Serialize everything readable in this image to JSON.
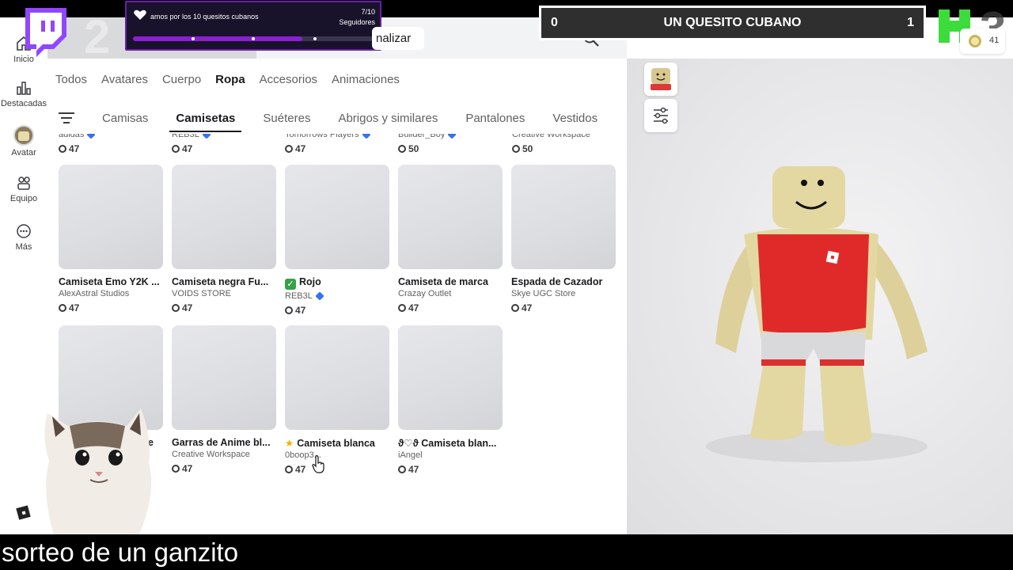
{
  "sidebar": {
    "items": [
      {
        "label": "Inicio",
        "icon": "home-icon"
      },
      {
        "label": "Destacadas",
        "icon": "chart-icon"
      },
      {
        "label": "Avatar",
        "icon": "avatar-icon"
      },
      {
        "label": "Equipo",
        "icon": "team-icon"
      },
      {
        "label": "Más",
        "icon": "more-icon"
      }
    ]
  },
  "header": {
    "finalize_label": "nalizar"
  },
  "categories": [
    "Todos",
    "Avatares",
    "Cuerpo",
    "Ropa",
    "Accesorios",
    "Animaciones"
  ],
  "active_category": "Ropa",
  "subcategories": [
    "Camisas",
    "Camisetas",
    "Suéteres",
    "Abrigos y similares",
    "Pantalones",
    "Vestidos"
  ],
  "active_subcategory": "Camisetas",
  "top_row": [
    {
      "creator": "adidas",
      "price": "47",
      "verified": true
    },
    {
      "creator": "REB3L",
      "price": "47",
      "verified": true
    },
    {
      "creator": "Tomorrows Players",
      "price": "47",
      "verified": true
    },
    {
      "creator": "Builder_Boy",
      "price": "50",
      "verified": true
    },
    {
      "creator": "Creative Workspace",
      "price": "50",
      "verified": false
    }
  ],
  "items": [
    {
      "name": "Camiseta Emo Y2K ...",
      "creator": "AlexAstral Studios",
      "price": "47"
    },
    {
      "name": "Camiseta negra Fu...",
      "creator": "VOIDS STORE",
      "price": "47"
    },
    {
      "name": "Rojo",
      "creator": "REB3L",
      "price": "47",
      "prefix": "check",
      "verified": true
    },
    {
      "name": "Camiseta de marca",
      "creator": "Crazay Outlet",
      "price": "47"
    },
    {
      "name": "Espada de Cazador",
      "creator": "Skye UGC Store",
      "price": "47"
    },
    {
      "name": "e",
      "creator": "",
      "price": "47"
    },
    {
      "name": "Garras de Anime bl...",
      "creator": "Creative Workspace",
      "price": "47"
    },
    {
      "name": "Camiseta blanca",
      "creator": "0boop3...",
      "price": "47",
      "prefix": "star"
    },
    {
      "name": "ϑ♡ϑ Camiseta blan...",
      "creator": "iAngel",
      "price": "47"
    }
  ],
  "preview": {
    "robux_balance": "41"
  },
  "stream": {
    "goal_label": "amos por los 10 quesitos cubanos",
    "goal_count": "7/10",
    "goal_unit": "Seguidores",
    "goal_progress": 0.7,
    "score_left": "0",
    "score_title": "UN QUESITO CUBANO",
    "score_right": "1",
    "big_number_left": "2",
    "big_number_right": "3",
    "caption": "sorteo de un ganzito",
    "colors": {
      "goal_fill": "#8a1fd0",
      "goal_border": "#6b1fa8",
      "twitch": "#9146ff",
      "brand_green": "#3ddc3d"
    }
  }
}
